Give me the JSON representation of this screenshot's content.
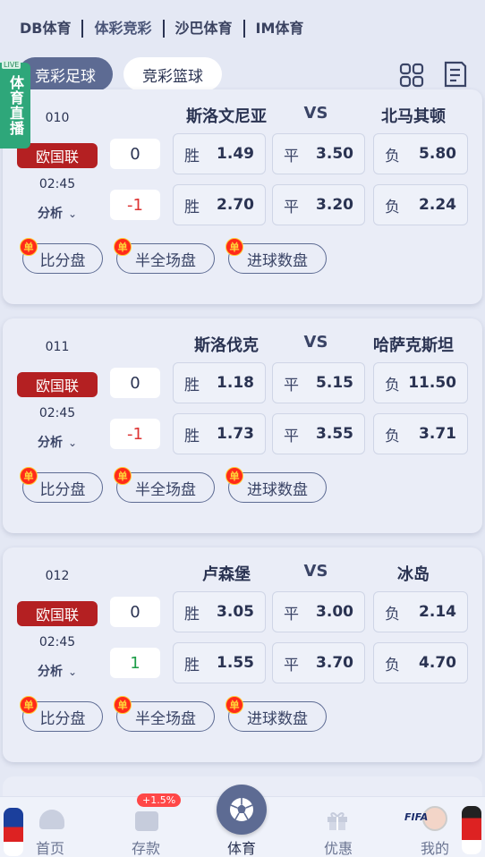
{
  "providers": [
    "DB体育",
    "体彩竞彩",
    "沙巴体育",
    "IM体育"
  ],
  "sport_tabs": {
    "active": "竞彩足球",
    "inactive": "竞彩篮球"
  },
  "live_ribbon": {
    "tag": "LIVE",
    "text": "体育直播"
  },
  "icons": {
    "grid": "grid-icon",
    "list": "list-icon"
  },
  "colors": {
    "accent": "#5d6b93",
    "league_red": "#b42022",
    "negative": "#dd3333",
    "positive": "#1c9c47"
  },
  "matches": [
    {
      "num": "010",
      "home": "斯洛文尼亚",
      "vs": "VS",
      "away": "北马其顿",
      "league": "欧国联",
      "time": "02:45",
      "analyze": "分析",
      "handicap1": "0",
      "handicap2": "-1",
      "row1": {
        "win_lbl": "胜",
        "win": "1.49",
        "draw_lbl": "平",
        "draw": "3.50",
        "lose_lbl": "负",
        "lose": "5.80"
      },
      "row2": {
        "win_lbl": "胜",
        "win": "2.70",
        "draw_lbl": "平",
        "draw": "3.20",
        "lose_lbl": "负",
        "lose": "2.24"
      },
      "markets": [
        "比分盘",
        "半全场盘",
        "进球数盘"
      ],
      "single": "单"
    },
    {
      "num": "011",
      "home": "斯洛伐克",
      "vs": "VS",
      "away": "哈萨克斯坦",
      "league": "欧国联",
      "time": "02:45",
      "analyze": "分析",
      "handicap1": "0",
      "handicap2": "-1",
      "row1": {
        "win_lbl": "胜",
        "win": "1.18",
        "draw_lbl": "平",
        "draw": "5.15",
        "lose_lbl": "负",
        "lose": "11.50"
      },
      "row2": {
        "win_lbl": "胜",
        "win": "1.73",
        "draw_lbl": "平",
        "draw": "3.55",
        "lose_lbl": "负",
        "lose": "3.71"
      },
      "markets": [
        "比分盘",
        "半全场盘",
        "进球数盘"
      ],
      "single": "单"
    },
    {
      "num": "012",
      "home": "卢森堡",
      "vs": "VS",
      "away": "冰岛",
      "league": "欧国联",
      "time": "02:45",
      "analyze": "分析",
      "handicap1": "0",
      "handicap2": "1",
      "row1": {
        "win_lbl": "胜",
        "win": "3.05",
        "draw_lbl": "平",
        "draw": "3.00",
        "lose_lbl": "负",
        "lose": "2.14"
      },
      "row2": {
        "win_lbl": "胜",
        "win": "1.55",
        "draw_lbl": "平",
        "draw": "3.70",
        "lose_lbl": "负",
        "lose": "4.70"
      },
      "markets": [
        "比分盘",
        "半全场盘",
        "进球数盘"
      ],
      "single": "单"
    }
  ],
  "nav": {
    "home": "首页",
    "deposit": "存款",
    "sports": "体育",
    "promo": "优惠",
    "mine": "我的",
    "deposit_badge": "+1.5%",
    "fifa": "FIFA"
  }
}
